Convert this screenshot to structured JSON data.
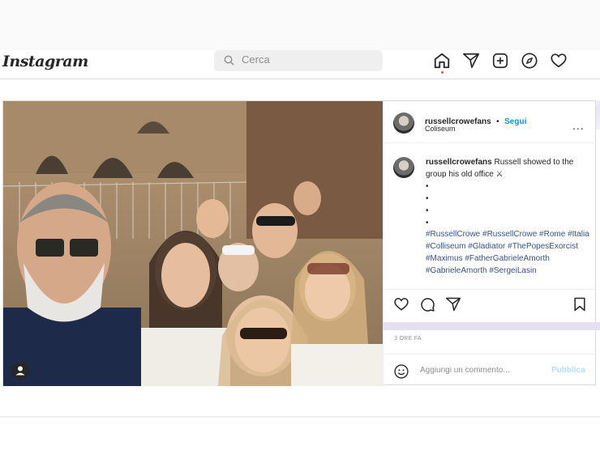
{
  "navbar": {
    "logo": "Instagram",
    "search_placeholder": "Cerca",
    "icons": [
      "home-icon",
      "send-icon",
      "new-post-icon",
      "explore-icon",
      "heart-icon"
    ]
  },
  "post": {
    "username": "russellcrowefans",
    "separator": "•",
    "follow_label": "Segui",
    "location": "Coliseum",
    "more_label": "...",
    "caption_user": "russellcrowefans",
    "caption_text": " Russell showed to the group his old office ⚔",
    "bullets": [
      "•",
      "•",
      "•",
      "•"
    ],
    "hashtags": "#RussellCrowe #RussellCrowe #Rome #Italia #Colliseum #Gladiator #ThePopesExorcist #Maximus #FatherGabrieleAmorth #GabrieleAmorth #SergeiLasin",
    "time": "3 ORE FA",
    "comment_placeholder": "Aggiungi un commento...",
    "publish_label": "Pubblica"
  },
  "colors": {
    "accent": "#0095f6",
    "notification_dot": "#ed4956",
    "publish_disabled": "#b2dffc"
  }
}
